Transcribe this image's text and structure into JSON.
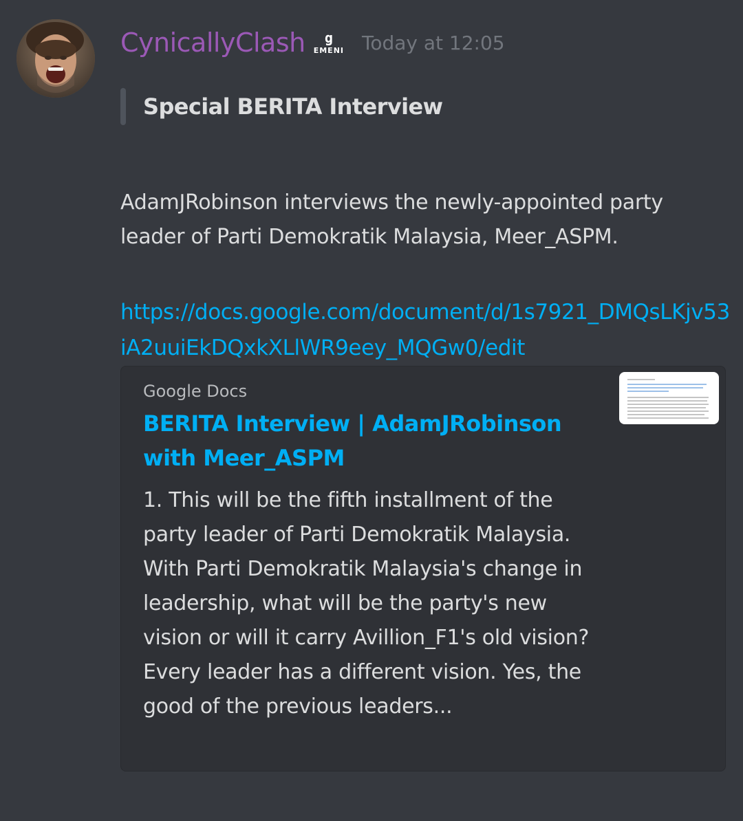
{
  "message": {
    "username": "CynicallyClash",
    "server_tag": {
      "glyph": "g",
      "label": "EMENI"
    },
    "timestamp": "Today at 12:05",
    "quote": "Special BERITA Interview",
    "body": "AdamJRobinson interviews the newly-appointed party leader of Parti Demokratik Malaysia, Meer_ASPM.",
    "link": "https://docs.google.com/document/d/1s7921_DMQsLKjv53iA2uuiEkDQxkXLlWR9eey_MQGw0/edit"
  },
  "embed": {
    "provider": "Google Docs",
    "title": "BERITA Interview | AdamJRobinson with Meer_ASPM",
    "description": "1. This will be the fifth installment of the party leader of Parti Demokratik Malaysia. With Parti Demokratik Malaysia's change in leadership, what will be the party's new vision or will it carry Avillion_F1's old vision?  Every leader has a different vision. Yes, the good of the previous leaders..."
  },
  "colors": {
    "background": "#36393f",
    "username": "#9b59b6",
    "link": "#00aff4",
    "embed_background": "#2f3136"
  }
}
